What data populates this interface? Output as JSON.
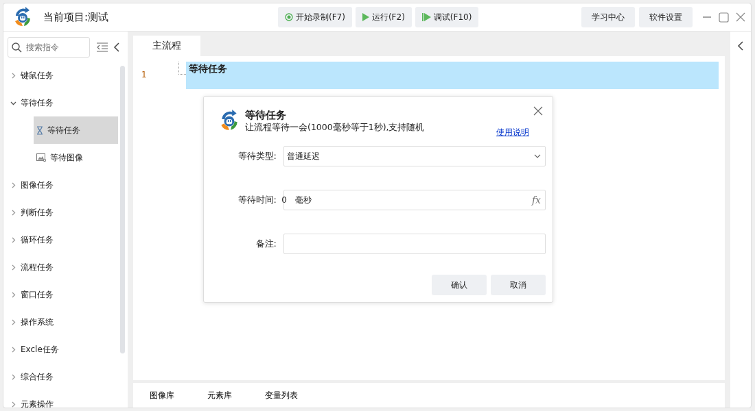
{
  "window": {
    "title": "当前项目:测试"
  },
  "toolbar": [
    {
      "label": "开始录制(F7)",
      "kind": "record"
    },
    {
      "label": "运行(F2)",
      "kind": "run"
    },
    {
      "label": "调试(F10)",
      "kind": "debug"
    }
  ],
  "top_buttons": [
    "学习中心",
    "软件设置"
  ],
  "sidebar": {
    "search": {
      "placeholder": "搜索指令"
    },
    "items": [
      {
        "label": "键鼠任务",
        "expanded": false
      },
      {
        "label": "等待任务",
        "expanded": true,
        "children": [
          {
            "label": "等待任务",
            "kind": "hourglass",
            "selected": true
          },
          {
            "label": "等待图像",
            "kind": "image",
            "selected": false
          }
        ]
      },
      {
        "label": "图像任务",
        "expanded": false
      },
      {
        "label": "判断任务",
        "expanded": false
      },
      {
        "label": "循环任务",
        "expanded": false
      },
      {
        "label": "流程任务",
        "expanded": false
      },
      {
        "label": "窗口任务",
        "expanded": false
      },
      {
        "label": "操作系统",
        "expanded": false
      },
      {
        "label": "Excle任务",
        "expanded": false
      },
      {
        "label": "综合任务",
        "expanded": false
      },
      {
        "label": "元素操作",
        "expanded": false
      }
    ]
  },
  "tabs": [
    {
      "label": "主流程",
      "selected": true
    }
  ],
  "editor": {
    "lines": [
      {
        "number": "1",
        "text": "等待任务",
        "selected": true
      }
    ]
  },
  "dialog": {
    "title": "等待任务",
    "description": "让流程等待一会(1000毫秒等于1秒),支持随机",
    "help_link": "使用说明",
    "fields": [
      {
        "label": "等待类型:",
        "kind": "select",
        "value": "普通延迟"
      },
      {
        "label": "等待时间:",
        "kind": "number",
        "value": "0",
        "unit": "毫秒",
        "suffix": "fx"
      },
      {
        "label": "备注:",
        "kind": "text"
      }
    ],
    "buttons": [
      "确认",
      "取消"
    ]
  },
  "bottom_tabs": [
    "图像库",
    "元素库",
    "变量列表"
  ]
}
